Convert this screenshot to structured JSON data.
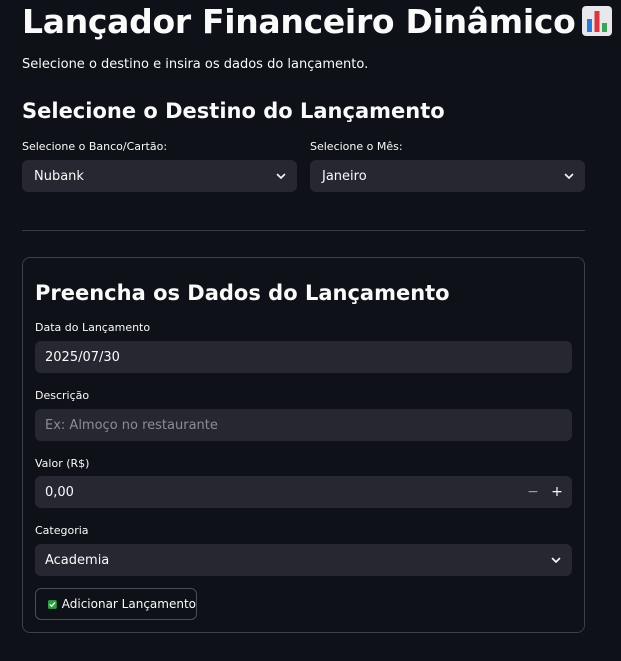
{
  "header": {
    "title": "Lançador Financeiro Dinâmico",
    "title_icon": "bar-chart-emoji",
    "subtitle": "Selecione o destino e insira os dados do lançamento."
  },
  "destination": {
    "heading": "Selecione o Destino do Lançamento",
    "bank_label": "Selecione o Banco/Cartão:",
    "bank_value": "Nubank",
    "month_label": "Selecione o Mês:",
    "month_value": "Janeiro"
  },
  "form": {
    "heading": "Preencha os Dados do Lançamento",
    "date_label": "Data do Lançamento",
    "date_value": "2025/07/30",
    "description_label": "Descrição",
    "description_placeholder": "Ex: Almoço no restaurante",
    "amount_label": "Valor (R$)",
    "amount_value": "0,00",
    "minus_label": "−",
    "plus_label": "+",
    "category_label": "Categoria",
    "category_value": "Academia",
    "submit_label": "Adicionar Lançamento",
    "submit_icon": "check-mark-emoji"
  },
  "colors": {
    "background": "#0e1117",
    "input_bg": "#262730",
    "text": "#fafafa",
    "placeholder": "#8b8d95",
    "check_green": "#2ea043"
  }
}
